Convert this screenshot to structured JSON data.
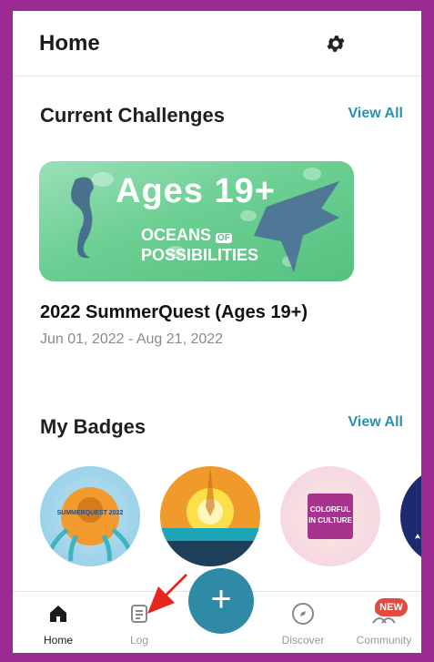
{
  "header": {
    "title": "Home"
  },
  "challenges": {
    "title": "Current Challenges",
    "view_all": "View All",
    "banner_title": "Ages 19+",
    "banner_sub_1": "OCEANS",
    "banner_sub_of": "OF",
    "banner_sub_2": "POSSIBILITIES",
    "name": "2022 SummerQuest (Ages 19+)",
    "dates": "Jun 01, 2022 - Aug 21, 2022"
  },
  "badges": {
    "title": "My Badges",
    "view_all": "View All",
    "badge1_text": "SUMMERQUEST 2022",
    "badge3_text": "COLORFUL IN CULTURE"
  },
  "nav": {
    "home": "Home",
    "log": "Log",
    "add": "+",
    "discover": "Discover",
    "community": "Community",
    "new_badge": "NEW"
  },
  "colors": {
    "frame": "#9b2a93",
    "accent": "#2e8aa5",
    "arrow": "#e8251c"
  }
}
